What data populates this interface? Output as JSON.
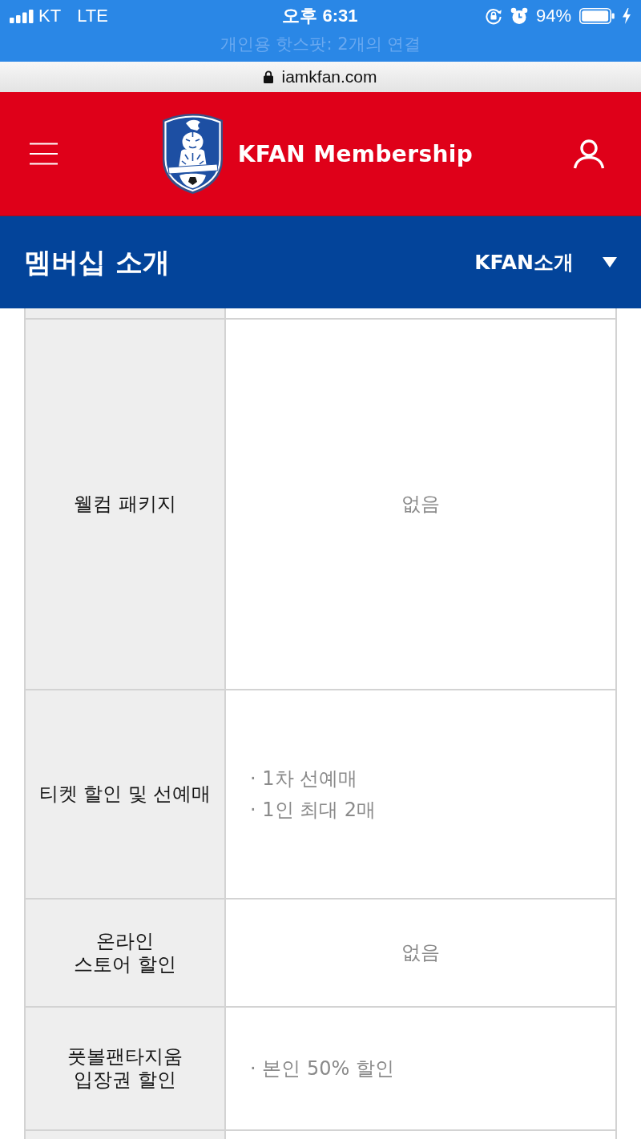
{
  "status_bar": {
    "carrier": "KT",
    "network": "LTE",
    "time": "오후 6:31",
    "battery": "94%",
    "hotspot": "개인용 핫스팟: 2개의 연결"
  },
  "address_bar": {
    "url": "iamkfan.com"
  },
  "header": {
    "title": "KFAN Membership"
  },
  "section_bar": {
    "title": "멤버십 소개",
    "dropdown": "KFAN소개"
  },
  "table": {
    "rows": [
      {
        "label": "웰컴 패키지",
        "kind": "text",
        "value": "없음"
      },
      {
        "label": "티켓 할인 및 선예매",
        "kind": "list",
        "items": [
          "· 1차 선예매",
          "· 1인 최대 2매"
        ]
      },
      {
        "label": "온라인\n스토어 할인",
        "kind": "text",
        "value": "없음"
      },
      {
        "label": "풋볼팬타지움\n입장권 할인",
        "kind": "list",
        "items": [
          "· 본인 50% 할인"
        ]
      }
    ]
  }
}
